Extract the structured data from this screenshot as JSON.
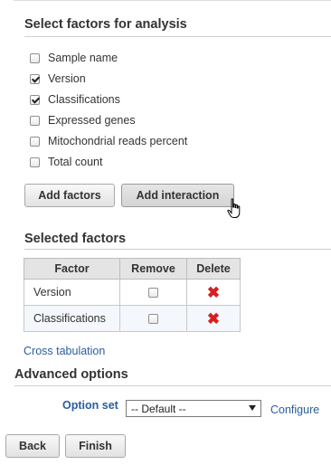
{
  "factors_section": {
    "title": "Select factors for analysis",
    "factors": [
      {
        "label": "Sample name",
        "checked": false
      },
      {
        "label": "Version",
        "checked": true
      },
      {
        "label": "Classifications",
        "checked": true
      },
      {
        "label": "Expressed genes",
        "checked": false
      },
      {
        "label": "Mitochondrial reads percent",
        "checked": false
      },
      {
        "label": "Total count",
        "checked": false
      }
    ],
    "add_factors_label": "Add factors",
    "add_interaction_label": "Add interaction"
  },
  "selected_section": {
    "title": "Selected factors",
    "columns": [
      "Factor",
      "Remove",
      "Delete"
    ],
    "rows": [
      {
        "factor": "Version",
        "remove_checked": false,
        "delete_icon": "red-x-icon"
      },
      {
        "factor": "Classifications",
        "remove_checked": false,
        "delete_icon": "red-x-icon"
      }
    ],
    "cross_tab_link": "Cross tabulation"
  },
  "advanced": {
    "title": "Advanced options",
    "option_set_label": "Option set",
    "option_set_value": "-- Default --",
    "configure_link": "Configure"
  },
  "footer": {
    "back_label": "Back",
    "finish_label": "Finish"
  },
  "colors": {
    "link": "#2a5d9f",
    "delete": "#d42020",
    "header_bg": "#e4e4e4",
    "alt_row": "#f4f7fb"
  }
}
